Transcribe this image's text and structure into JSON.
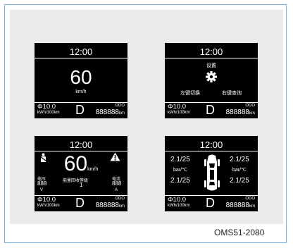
{
  "screens": {
    "speed": {
      "time": "12:00",
      "speed": "60",
      "speed_unit": "km/h",
      "efficiency": "Φ10.0",
      "efficiency_unit": "kWh/100km",
      "gear": "D",
      "odo_label": "ODO",
      "odo": "888888",
      "odo_unit": "km"
    },
    "settings": {
      "time": "12:00",
      "title": "设置",
      "icon": "gear-icon",
      "left_action": "左键切换",
      "right_action": "右键查询",
      "efficiency": "Φ10.0",
      "efficiency_unit": "kWh/100km",
      "gear": "D",
      "odo_label": "ODO",
      "odo": "888888",
      "odo_unit": "km"
    },
    "energy": {
      "time": "12:00",
      "speed": "60",
      "speed_unit": "km/h",
      "warning_icon": "warning-triangle-icon",
      "seat_icon": "seatbelt-icon",
      "voltage_label": "电压",
      "voltage_value": "888",
      "voltage_unit": "V",
      "regen_label": "能量回收等级",
      "regen_value": "1",
      "current_label": "电流",
      "current_value": "888",
      "current_unit": "A",
      "efficiency": "Φ10.0",
      "efficiency_unit": "kWh/100km",
      "gear": "D",
      "odo_label": "ODO",
      "odo": "888888",
      "odo_unit": "km"
    },
    "tyre": {
      "time": "12:00",
      "front_left": "2.1/25",
      "front_right": "2.1/25",
      "rear_left": "2.1/25",
      "rear_right": "2.1/25",
      "unit_left": "bar/℃",
      "unit_right": "bar/℃",
      "car_icon": "car-topview-icon",
      "efficiency": "Φ10.0",
      "efficiency_unit": "kWh/100km",
      "gear": "D",
      "odo_label": "ODO",
      "odo": "888888",
      "odo_unit": "km"
    }
  },
  "figure_code": "OMS51-2080"
}
